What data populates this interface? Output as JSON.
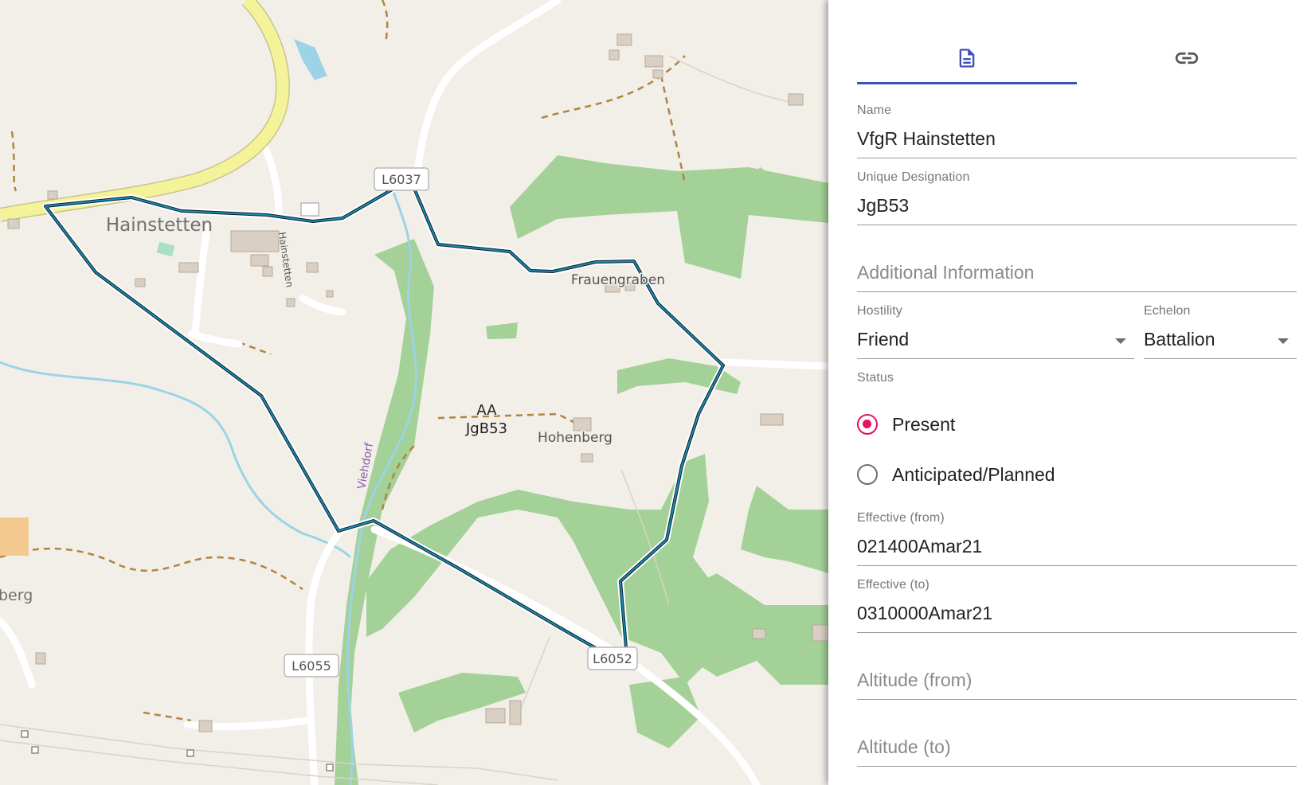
{
  "map": {
    "area_label_line1": "AA",
    "area_label_line2": "JgB53",
    "places": {
      "hainstetten": "Hainstetten",
      "frauengraben": "Frauengraben",
      "hohenberg": "Hohenberg",
      "berg": "berg"
    },
    "streets": {
      "hainstetten_street": "Hainstetten",
      "viehdorf": "Viehdorf"
    },
    "road_shields": {
      "l6037": "L6037",
      "l6055": "L6055",
      "l6052": "L6052"
    },
    "colors": {
      "background": "#f2efe9",
      "forest": "#a3d197",
      "main_road": "#f5f39a",
      "water": "#9cd3e6",
      "boundary": "#1a6f8c",
      "path": "#b08540"
    }
  },
  "panel": {
    "tabs": [
      {
        "icon": "document-icon",
        "selected": true
      },
      {
        "icon": "link-icon",
        "selected": false
      }
    ],
    "accent_color": "#3f51b5",
    "radio_color": "#e3135f",
    "name": {
      "label": "Name",
      "value": "VfgR Hainstetten"
    },
    "unique_designation": {
      "label": "Unique Designation",
      "value": "JgB53"
    },
    "additional_information": {
      "placeholder": "Additional Information"
    },
    "hostility": {
      "label": "Hostility",
      "value": "Friend"
    },
    "echelon": {
      "label": "Echelon",
      "value": "Battalion"
    },
    "status": {
      "label": "Status",
      "options": [
        {
          "label": "Present",
          "checked": true
        },
        {
          "label": "Anticipated/Planned",
          "checked": false
        }
      ]
    },
    "effective_from": {
      "label": "Effective (from)",
      "value": "021400Amar21"
    },
    "effective_to": {
      "label": "Effective (to)",
      "value": "0310000Amar21"
    },
    "altitude_from": {
      "placeholder": "Altitude (from)"
    },
    "altitude_to": {
      "placeholder": "Altitude (to)"
    }
  }
}
